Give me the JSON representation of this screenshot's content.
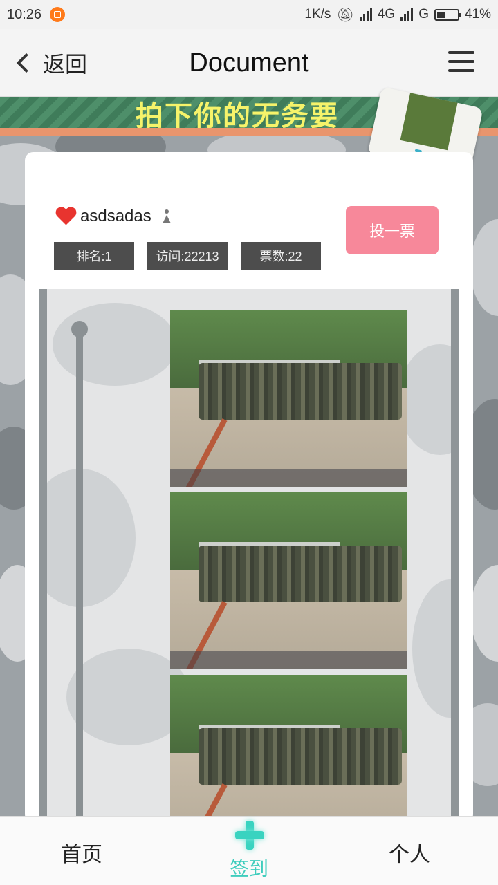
{
  "status_bar": {
    "time": "10:26",
    "net_speed": "1K/s",
    "network_1": "4G",
    "network_2": "G",
    "battery_percent": "41%",
    "battery_level": 0.41
  },
  "header": {
    "back_label": "返回",
    "title": "Document"
  },
  "banner": {
    "text": "拍下你的无务要"
  },
  "profile": {
    "username": "asdsadas",
    "rank": "排名:1",
    "visits": "访问:22213",
    "votes": "票数:22",
    "vote_button": "投一票"
  },
  "gallery": {
    "photos": [
      {
        "alt": "military-training-photo"
      },
      {
        "alt": "military-training-photo"
      },
      {
        "alt": "military-training-photo"
      }
    ]
  },
  "tabbar": {
    "home": "首页",
    "checkin": "签到",
    "profile": "个人"
  },
  "colors": {
    "accent_teal": "#39d3c0",
    "vote_pink": "#f7889a",
    "badge_dark": "#4d4d4d"
  }
}
